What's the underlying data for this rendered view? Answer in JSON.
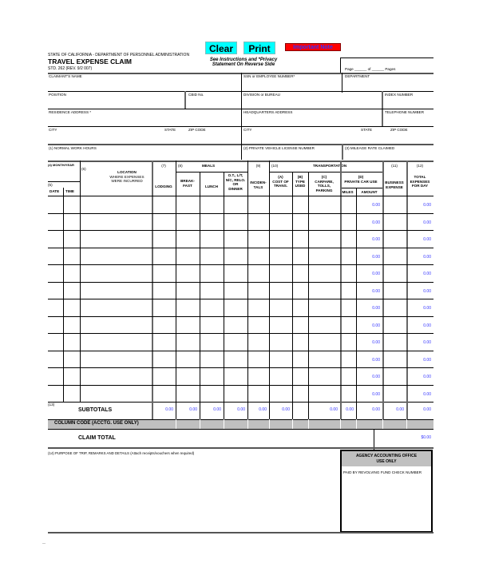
{
  "header": {
    "agency": "STATE OF CALIFORNIA  -  DEPARTMENT OF PERSONNEL ADMINISTRATION",
    "title": "TRAVEL EXPENSE CLAIM",
    "form_number": "STD. 262 (REV. 9/2 007)",
    "instructions": "See Instructions and *Privacy",
    "instructions_2": "Statement On Reverse Side",
    "page_label": "Page",
    "of_label": "of",
    "pages_label": "Pages"
  },
  "buttons": {
    "clear": "Clear",
    "print": "Print",
    "important_note": "Important Note"
  },
  "fields": {
    "claimant_name": "CLAIMANT'S NAME",
    "ssn": "SSN or EMPLOYEE NUMBER*",
    "department": "DEPARTMENT",
    "position": "POSITION",
    "cbid": "CBID No.",
    "division": "DIVISION or BUREAU",
    "index_number": "INDEX NUMBER",
    "residence_address": "RESIDENCE ADDRESS *",
    "hq_address": "HEADQUARTERS ADDRESS",
    "telephone": "TELEPHONE NUMBER",
    "city": "CITY",
    "state": "STATE",
    "zip": "ZIP CODE",
    "hq_city": "CITY",
    "hq_state": "STATE",
    "hq_zip": "ZIP CODE",
    "work_hours": "(1) NORMAL WORK HOURS",
    "license": "(2) PRIVATE VEHICLE LICENSE NUMBER",
    "mileage_rate": "(3) MILEAGE RATE CLAIMED"
  },
  "table": {
    "h4": "(4) MONTH/YEAR",
    "h5": "(5)",
    "date": "DATE",
    "time": "TIME",
    "h6": "(6)",
    "location_1": "LOCATION",
    "location_2": "WHERE EXPENSES",
    "location_3": "WERE INCURRED",
    "h7": "(7)",
    "lodging": "LODGING",
    "h8": "(8)",
    "meals": "MEALS",
    "breakfast_1": "BREAK-",
    "breakfast_2": "FAST",
    "lunch": "LUNCH",
    "dinner_1": "O.T., L/T,",
    "dinner_2": "N/C, RELO.",
    "dinner_3": "OR",
    "dinner_4": "DINNER",
    "h9": "(9)",
    "incidentals_1": "INCIDEN-",
    "incidentals_2": "TALS",
    "h10": "(10)",
    "transportation": "TRANSPORTATION",
    "a": "(A)",
    "cost_1": "COST OF",
    "cost_2": "TRANS.",
    "b": "(B)",
    "type_1": "TYPE",
    "type_2": "USED",
    "c": "(C)",
    "carfare_1": "CARFARE,",
    "carfare_2": "TOLLS,",
    "carfare_3": "PARKING",
    "d": "(D)",
    "private_car": "PRIVATE CAR USE",
    "miles": "MILES",
    "amount": "AMOUNT",
    "h11": "(11)",
    "business_1": "BUSINESS",
    "business_2": "EXPENSE",
    "h12": "(12)",
    "total_1": "TOTAL",
    "total_2": "EXPENSES",
    "total_3": "FOR DAY",
    "rows": [
      {
        "amount": "0.00",
        "total": "0.00"
      },
      {
        "amount": "0.00",
        "total": "0.00"
      },
      {
        "amount": "0.00",
        "total": "0.00"
      },
      {
        "amount": "0.00",
        "total": "0.00"
      },
      {
        "amount": "0.00",
        "total": "0.00"
      },
      {
        "amount": "0.00",
        "total": "0.00"
      },
      {
        "amount": "0.00",
        "total": "0.00"
      },
      {
        "amount": "0.00",
        "total": "0.00"
      },
      {
        "amount": "0.00",
        "total": "0.00"
      },
      {
        "amount": "0.00",
        "total": "0.00"
      },
      {
        "amount": "0.00",
        "total": "0.00"
      },
      {
        "amount": "0.00",
        "total": "0.00"
      }
    ],
    "h13": "(13)",
    "subtotals_label": "SUBTOTALS",
    "subtotals": {
      "lodging": "0.00",
      "breakfast": "0.00",
      "lunch": "0.00",
      "dinner": "0.00",
      "incidentals": "0.00",
      "cost": "0.00",
      "carfare": "0.00",
      "miles": "0.00",
      "amount": "0.00",
      "business": "0.00",
      "total": "0.00"
    },
    "column_code": "COLUMN CODE (ACCTG. USE ONLY)",
    "claim_total_label": "CLAIM TOTAL",
    "claim_total": "$0.00"
  },
  "footer": {
    "purpose": "(14) PURPOSE OF TRIP, REMARKS AND DETAILS",
    "purpose_note": "(Attach receipts/vouchers when required)",
    "agency_office_1": "AGENCY ACCOUNTING OFFICE",
    "agency_office_2": "USE ONLY",
    "paid_by": "PAID BY REVOLVING FUND CHECK NUMBER"
  }
}
